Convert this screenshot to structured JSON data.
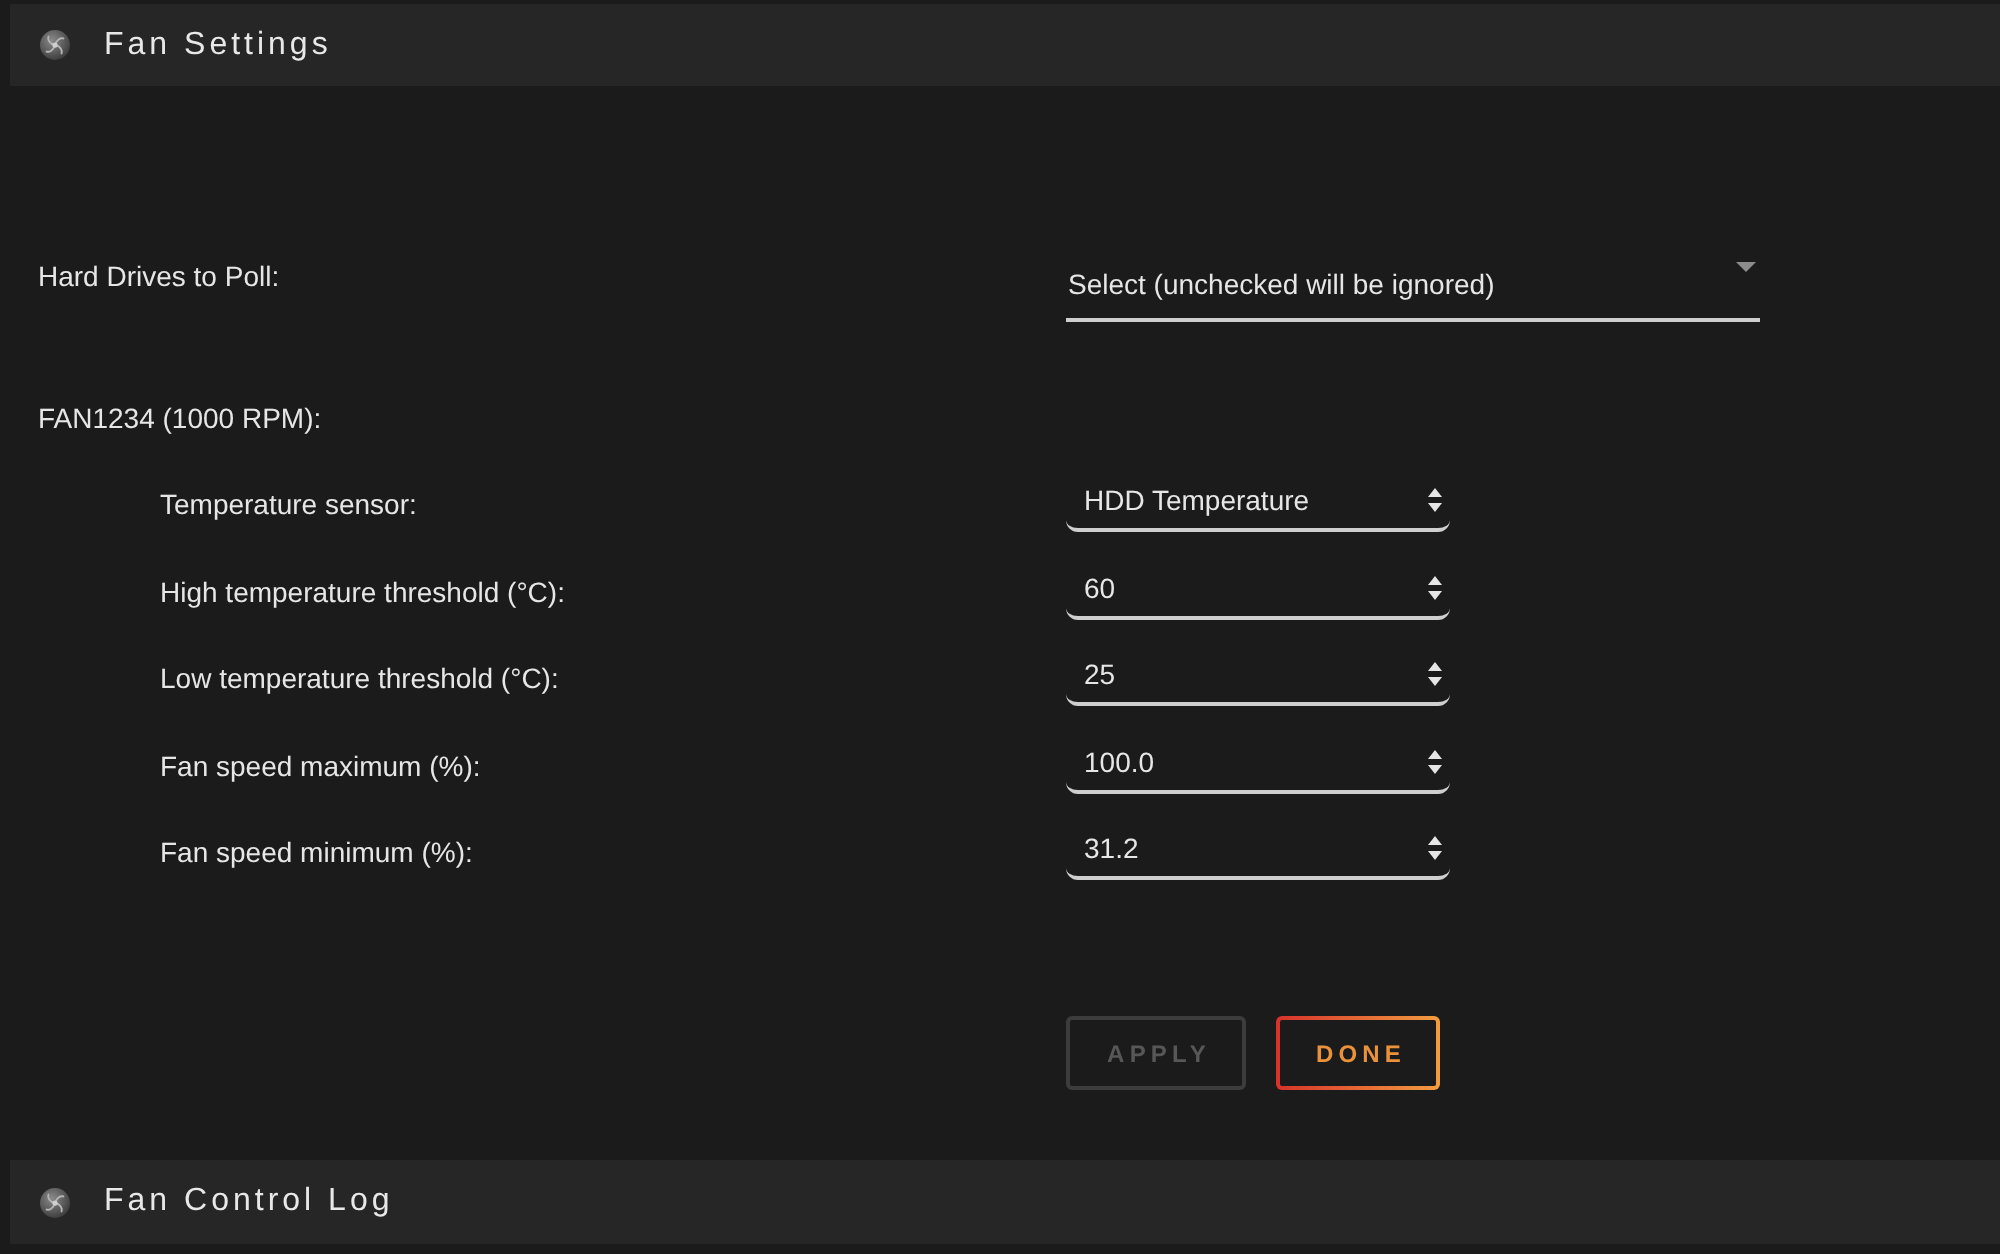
{
  "settings_panel": {
    "title": "Fan Settings"
  },
  "hard_drives": {
    "label": "Hard Drives to Poll:",
    "placeholder": "Select (unchecked will be ignored)"
  },
  "fan": {
    "label": "FAN1234 (1000 RPM):",
    "settings": [
      {
        "label": "Temperature sensor:",
        "value": "HDD Temperature"
      },
      {
        "label": "High temperature threshold (°C):",
        "value": "60"
      },
      {
        "label": "Low temperature threshold (°C):",
        "value": "25"
      },
      {
        "label": "Fan speed maximum (%):",
        "value": "100.0"
      },
      {
        "label": "Fan speed minimum (%):",
        "value": "31.2"
      }
    ]
  },
  "buttons": [
    {
      "label": "APPLY",
      "disabled": true
    },
    {
      "label": "DONE",
      "disabled": false
    }
  ],
  "log_panel": {
    "title": "Fan Control Log"
  }
}
